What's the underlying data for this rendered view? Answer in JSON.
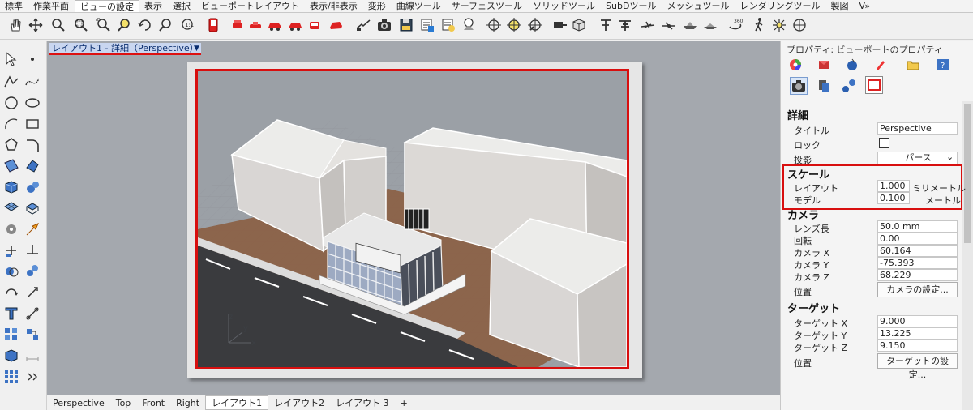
{
  "tabs": [
    "標準",
    "作業平面",
    "ビューの設定",
    "表示",
    "選択",
    "ビューポートレイアウト",
    "表示/非表示",
    "変形",
    "曲線ツール",
    "サーフェスツール",
    "ソリッドツール",
    "SubDツール",
    "メッシュツール",
    "レンダリングツール",
    "製図",
    "V»"
  ],
  "active_tab": "ビューの設定",
  "viewport": {
    "title": "レイアウト1 - 詳細（Perspective）",
    "dropdown_glyph": "▼",
    "axis_labels": {
      "z": "z",
      "y": "y",
      "x": "x"
    }
  },
  "bottom_tabs": [
    "Perspective",
    "Top",
    "Front",
    "Right",
    "レイアウト1",
    "レイアウト2",
    "レイアウト 3"
  ],
  "bottom_add": "+",
  "panel": {
    "title": "プロパティ: ビューポートのプロパティ",
    "detail": {
      "header": "詳細",
      "title_label": "タイトル",
      "title_value": "Perspective",
      "lock_label": "ロック",
      "projection_label": "投影",
      "projection_value": "パース"
    },
    "scale": {
      "header": "スケール",
      "layout_label": "レイアウト",
      "layout_value": "1.000",
      "layout_unit": "ミリメートル",
      "model_label": "モデル",
      "model_value": "0.100",
      "model_unit": "メートル"
    },
    "camera": {
      "header": "カメラ",
      "lens_label": "レンズ長",
      "lens_value": "50.0 mm",
      "rotation_label": "回転",
      "rotation_value": "0.00",
      "x_label": "カメラ X",
      "x_value": "60.164",
      "y_label": "カメラ Y",
      "y_value": "-75.393",
      "z_label": "カメラ Z",
      "z_value": "68.229",
      "position_label": "位置",
      "position_button": "カメラの設定..."
    },
    "target": {
      "header": "ターゲット",
      "x_label": "ターゲット X",
      "x_value": "9.000",
      "y_label": "ターゲット Y",
      "y_value": "13.225",
      "z_label": "ターゲット Z",
      "z_value": "9.150",
      "position_label": "位置",
      "position_button": "ターゲットの設定..."
    }
  },
  "colors": {
    "accent_red": "#d80f0f",
    "viewport_bg": "#9ba0a6",
    "ground": "#8a5a3c",
    "building": "#d9d6d4"
  }
}
